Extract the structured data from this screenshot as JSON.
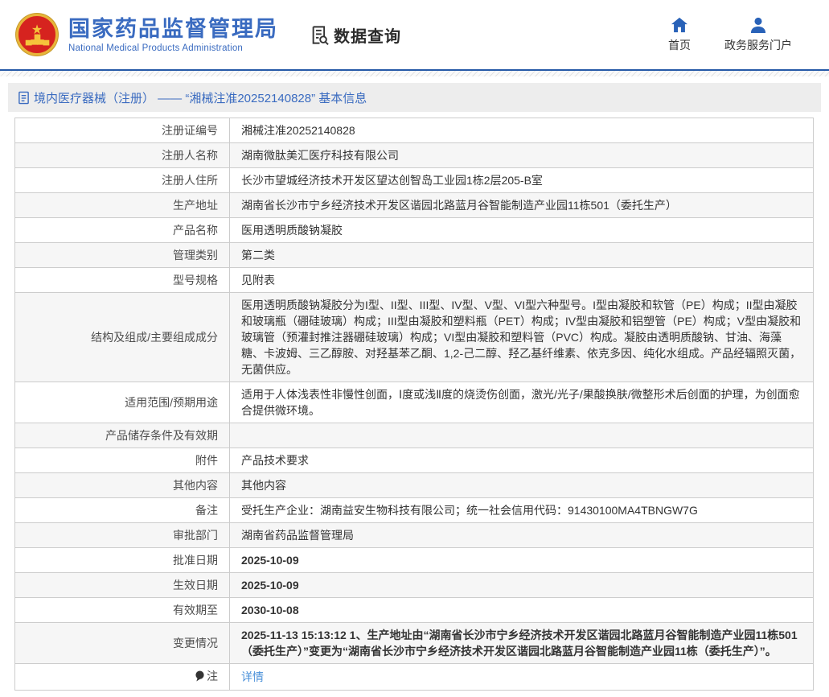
{
  "header": {
    "logo": {
      "emblem_icon": "national-emblem-icon",
      "title_cn": "国家药品监督管理局",
      "title_en": "National Medical Products Administration"
    },
    "section": {
      "icon": "data-query-icon",
      "label": "数据查询"
    },
    "nav": [
      {
        "icon": "home-icon",
        "label": "首页"
      },
      {
        "icon": "user-icon",
        "label": "政务服务门户"
      }
    ]
  },
  "breadcrumb": {
    "icon": "document-icon",
    "text": "境内医疗器械（注册） —— “湘械注准20252140828” 基本信息"
  },
  "table": {
    "rows": [
      {
        "label": "注册证编号",
        "value": "湘械注准20252140828"
      },
      {
        "label": "注册人名称",
        "value": "湖南微肽美汇医疗科技有限公司"
      },
      {
        "label": "注册人住所",
        "value": "长沙市望城经济技术开发区望达创智岛工业园1栋2层205-B室"
      },
      {
        "label": "生产地址",
        "value": "湖南省长沙市宁乡经济技术开发区谐园北路蓝月谷智能制造产业园11栋501（委托生产）"
      },
      {
        "label": "产品名称",
        "value": "医用透明质酸钠凝胶"
      },
      {
        "label": "管理类别",
        "value": "第二类"
      },
      {
        "label": "型号规格",
        "value": "见附表"
      },
      {
        "label": "结构及组成/主要组成成分",
        "value": "医用透明质酸钠凝胶分为I型、II型、III型、IV型、V型、VI型六种型号。I型由凝胶和软管（PE）构成；II型由凝胶和玻璃瓶（硼硅玻璃）构成；III型由凝胶和塑料瓶（PET）构成；IV型由凝胶和铝塑管（PE）构成；V型由凝胶和玻璃管（预灌封推注器硼硅玻璃）构成；VI型由凝胶和塑料管（PVC）构成。凝胶由透明质酸钠、甘油、海藻糖、卡波姆、三乙醇胺、对羟基苯乙酮、1,2-己二醇、羟乙基纤维素、依克多因、纯化水组成。产品经辐照灭菌，无菌供应。"
      },
      {
        "label": "适用范围/预期用途",
        "value": "适用于人体浅表性非慢性创面，Ⅰ度或浅Ⅱ度的烧烫伤创面，激光/光子/果酸换肤/微整形术后创面的护理，为创面愈合提供微环境。"
      },
      {
        "label": "产品储存条件及有效期",
        "value": ""
      },
      {
        "label": "附件",
        "value": "产品技术要求"
      },
      {
        "label": "其他内容",
        "value": "其他内容"
      },
      {
        "label": "备注",
        "value": "受托生产企业：湖南益安生物科技有限公司；统一社会信用代码：91430100MA4TBNGW7G"
      },
      {
        "label": "审批部门",
        "value": "湖南省药品监督管理局"
      },
      {
        "label": "批准日期",
        "value": "2025-10-09"
      },
      {
        "label": "生效日期",
        "value": "2025-10-09"
      },
      {
        "label": "有效期至",
        "value": "2030-10-08"
      },
      {
        "label": "变更情况",
        "value": "2025-11-13 15:13:12 1、生产地址由“湖南省长沙市宁乡经济技术开发区谐园北路蓝月谷智能制造产业园11栋501（委托生产）”变更为“湖南省长沙市宁乡经济技术开发区谐园北路蓝月谷智能制造产业园11栋（委托生产）”。"
      },
      {
        "label": "注",
        "value": "详情",
        "note_icon": "comment-icon",
        "is_link": true
      }
    ]
  },
  "colors": {
    "brand_blue": "#3a6bc0",
    "header_line_blue": "#2559a7",
    "link_blue": "#4a90d9",
    "emblem_red": "#d6231f",
    "emblem_gold": "#e8b53a",
    "row_alt_gray": "#f6f6f6",
    "table_border": "#cccccc"
  }
}
